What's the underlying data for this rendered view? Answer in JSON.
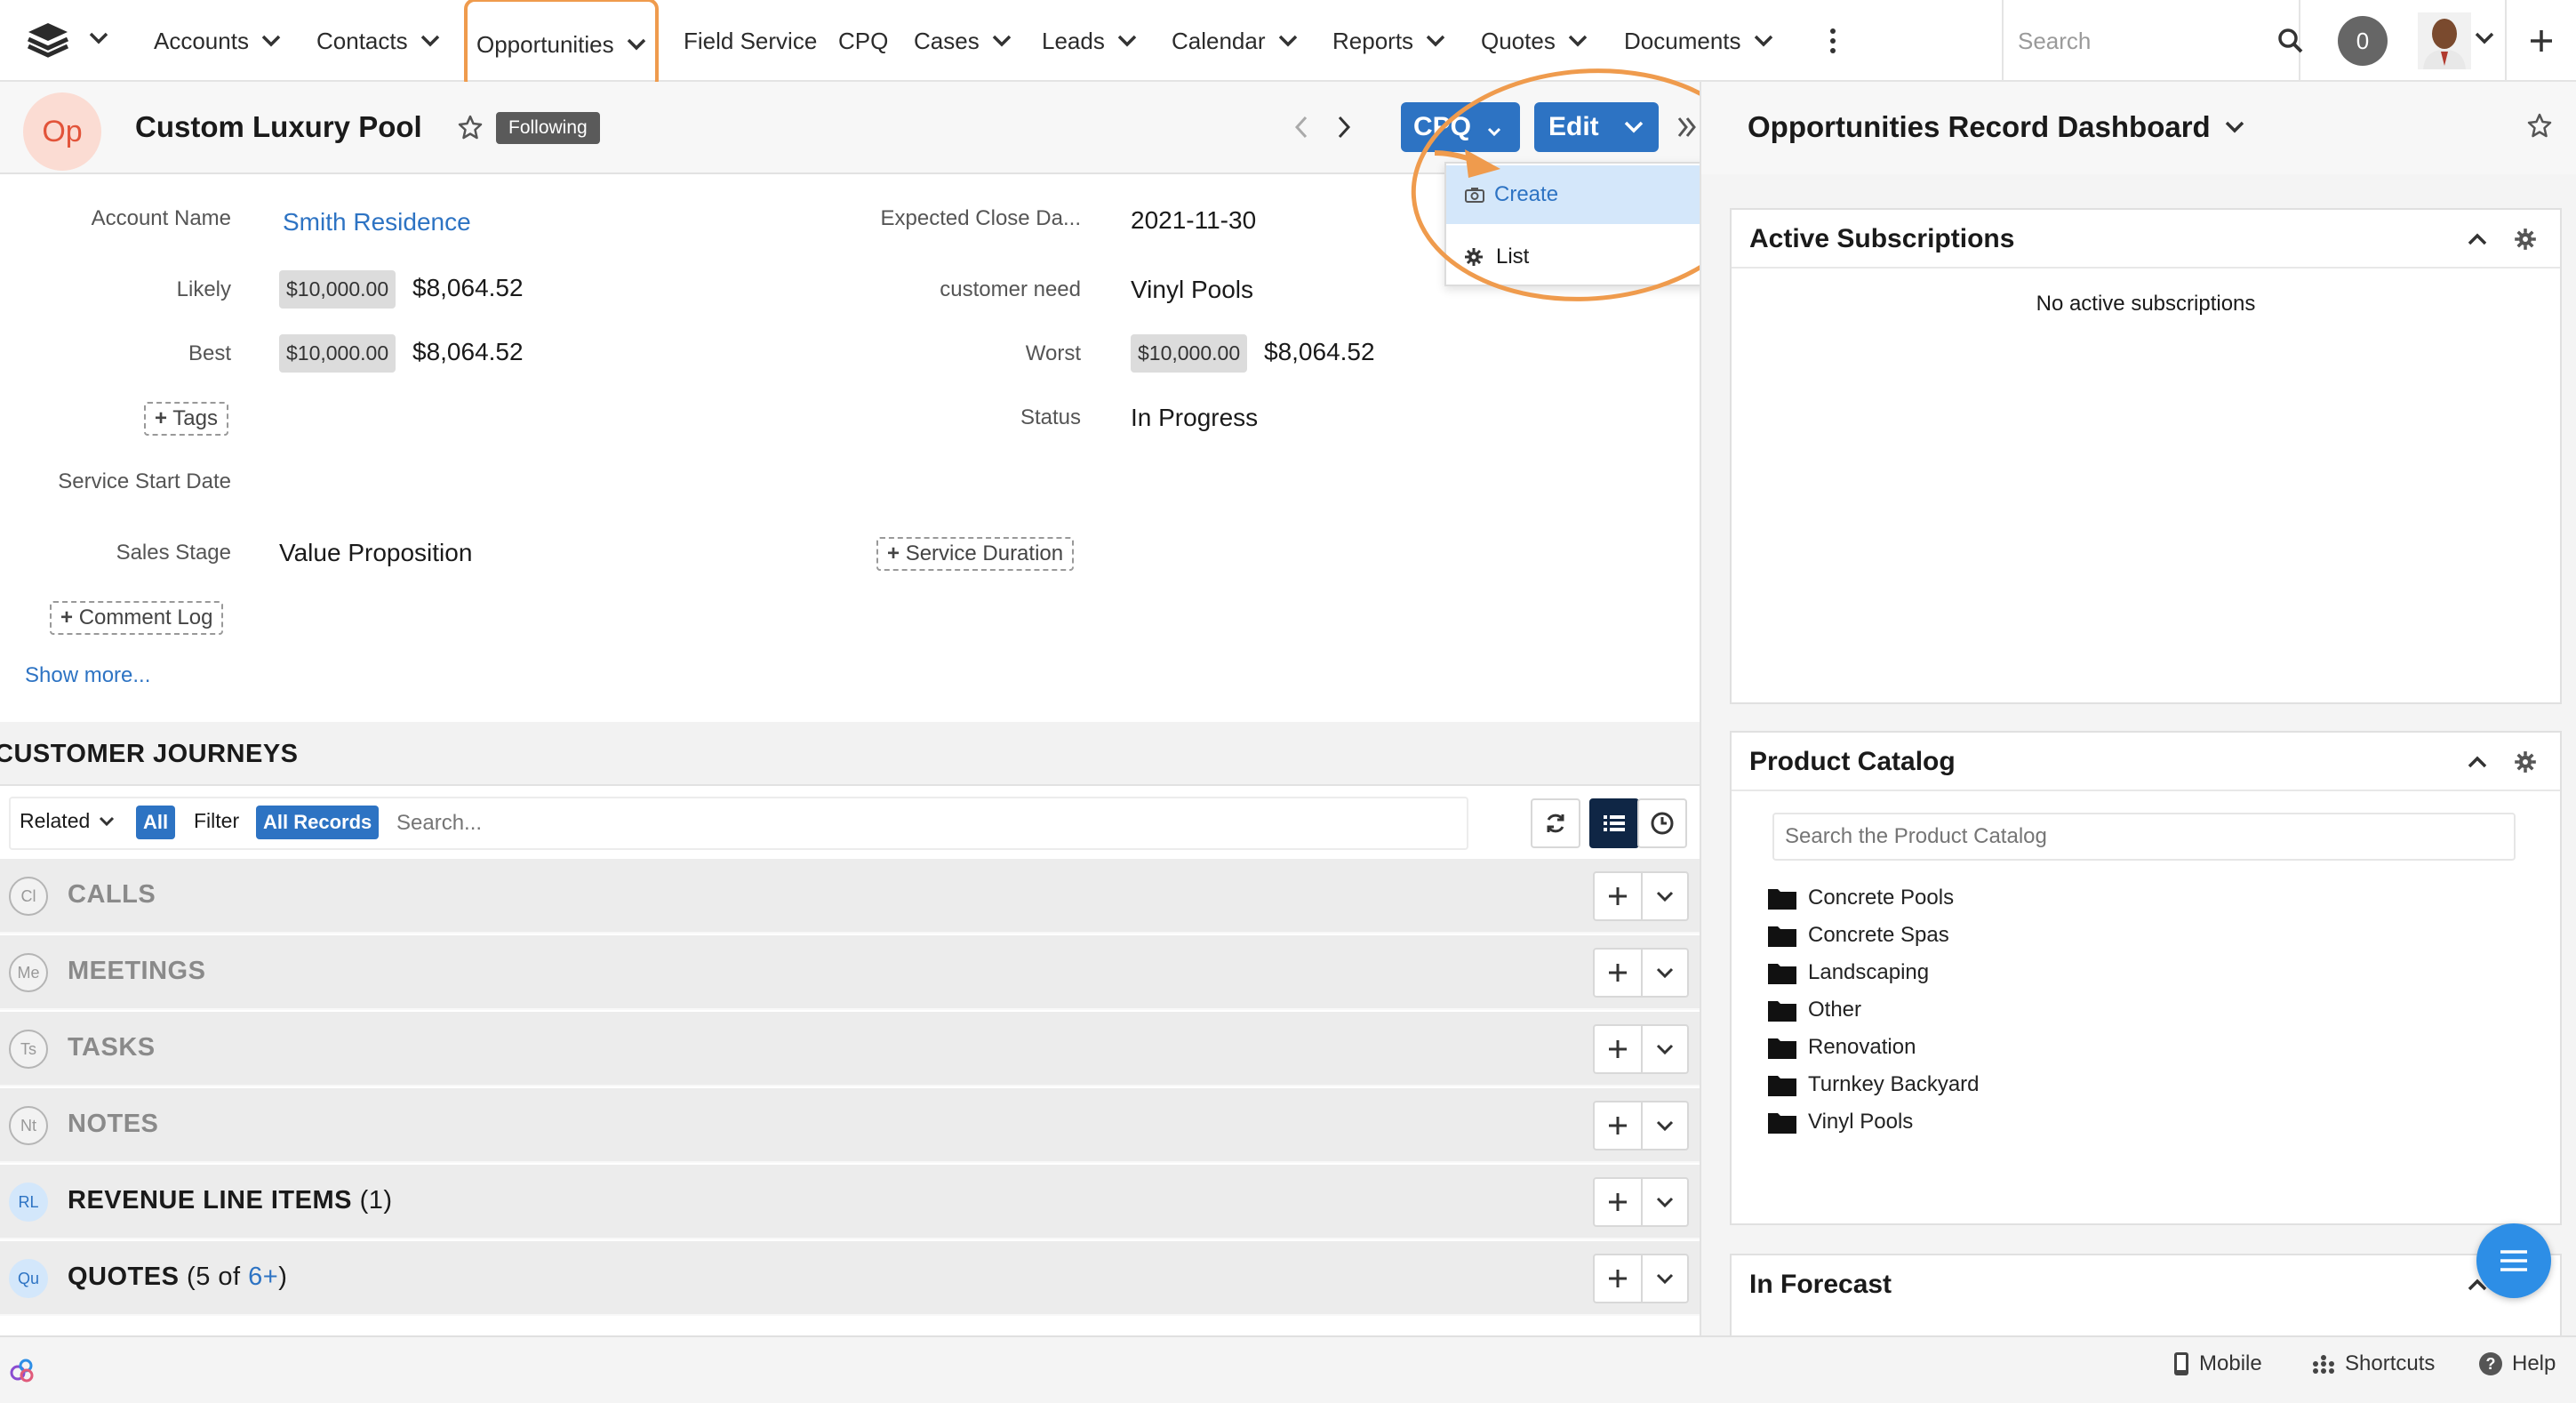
{
  "nav": {
    "items": [
      {
        "label": "Accounts",
        "has_menu": true
      },
      {
        "label": "Contacts",
        "has_menu": true
      },
      {
        "label": "Opportunities",
        "has_menu": true,
        "active": true
      },
      {
        "label": "Field Service",
        "has_menu": false
      },
      {
        "label": "CPQ",
        "has_menu": false
      },
      {
        "label": "Cases",
        "has_menu": true
      },
      {
        "label": "Leads",
        "has_menu": true
      },
      {
        "label": "Calendar",
        "has_menu": true
      },
      {
        "label": "Reports",
        "has_menu": true
      },
      {
        "label": "Quotes",
        "has_menu": true
      },
      {
        "label": "Documents",
        "has_menu": true
      }
    ],
    "search_placeholder": "Search",
    "notification_count": "0"
  },
  "record": {
    "module_initials": "Op",
    "title": "Custom Luxury Pool",
    "following_label": "Following",
    "cpq_button": "CPQ",
    "edit_button": "Edit",
    "cpq_menu": [
      {
        "label": "Create",
        "icon": "camera-icon"
      },
      {
        "label": "List",
        "icon": "gear-icon"
      }
    ]
  },
  "fields": {
    "account_name": {
      "label": "Account Name",
      "value": "Smith Residence"
    },
    "expected_close": {
      "label": "Expected Close Da...",
      "value": "2021-11-30"
    },
    "likely": {
      "label": "Likely",
      "original": "$10,000.00",
      "converted": "$8,064.52"
    },
    "customer_need": {
      "label": "customer need",
      "value": "Vinyl Pools"
    },
    "best": {
      "label": "Best",
      "original": "$10,000.00",
      "converted": "$8,064.52"
    },
    "worst": {
      "label": "Worst",
      "original": "$10,000.00",
      "converted": "$8,064.52"
    },
    "tags_button": "Tags",
    "status": {
      "label": "Status",
      "value": "In Progress"
    },
    "service_start": {
      "label": "Service Start Date",
      "value": ""
    },
    "sales_stage": {
      "label": "Sales Stage",
      "value": "Value Proposition"
    },
    "service_duration_button": "Service Duration",
    "comment_log_button": "Comment Log",
    "show_more": "Show more..."
  },
  "subpanels": {
    "section_title": "CUSTOMER JOURNEYS",
    "related_label": "Related",
    "all_pill": "All",
    "filter_label": "Filter",
    "all_records_pill": "All Records",
    "search_placeholder": "Search...",
    "rows": [
      {
        "initials": "Cl",
        "label": "CALLS",
        "count": "",
        "count_link": "",
        "active": false
      },
      {
        "initials": "Me",
        "label": "MEETINGS",
        "count": "",
        "count_link": "",
        "active": false
      },
      {
        "initials": "Ts",
        "label": "TASKS",
        "count": "",
        "count_link": "",
        "active": false
      },
      {
        "initials": "Nt",
        "label": "NOTES",
        "count": "",
        "count_link": "",
        "active": false
      },
      {
        "initials": "RL",
        "label": "REVENUE LINE ITEMS",
        "count": "(1)",
        "count_link": "",
        "active": true
      },
      {
        "initials": "Qu",
        "label": "QUOTES",
        "count": "(5 of ",
        "count_link": "6+",
        "count_tail": ")",
        "active": true
      }
    ]
  },
  "dashboard": {
    "title": "Opportunities Record Dashboard",
    "active_subscriptions": {
      "title": "Active Subscriptions",
      "empty_text": "No active subscriptions"
    },
    "product_catalog": {
      "title": "Product Catalog",
      "search_placeholder": "Search the Product Catalog",
      "items": [
        "Concrete Pools",
        "Concrete Spas",
        "Landscaping",
        "Other",
        "Renovation",
        "Turnkey Backyard",
        "Vinyl Pools"
      ]
    },
    "in_forecast": {
      "title": "In Forecast"
    }
  },
  "footer": {
    "mobile": "Mobile",
    "shortcuts": "Shortcuts",
    "help": "Help"
  },
  "colors": {
    "accent": "#2d73c3",
    "highlight": "#ef9b4d",
    "module_badge_bg": "#fbdcd3",
    "module_badge_fg": "#e2543a"
  }
}
